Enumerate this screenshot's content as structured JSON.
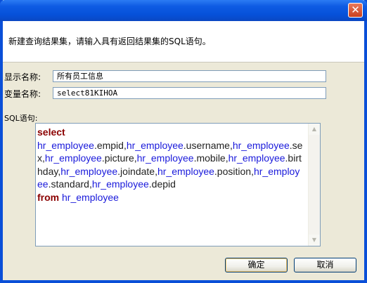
{
  "dialog": {
    "instruction": "新建查询结果集，请输入具有返回结果集的SQL语句。"
  },
  "fields": {
    "display_name_label": "显示名称:",
    "display_name_value": "所有员工信息",
    "variable_name_label": "变量名称:",
    "variable_name_value": "select81KIHOA",
    "sql_label": "SQL语句:"
  },
  "sql": {
    "tokens": [
      {
        "text": "select",
        "kind": "kw"
      },
      {
        "text": "\n"
      },
      {
        "text": " hr_employee",
        "kind": "tbl"
      },
      {
        "text": ".empid,",
        "kind": "col"
      },
      {
        "text": "hr_employee",
        "kind": "tbl"
      },
      {
        "text": ".username,",
        "kind": "col"
      },
      {
        "text": "hr_employee",
        "kind": "tbl"
      },
      {
        "text": ".sex,",
        "kind": "col"
      },
      {
        "text": "hr_employee",
        "kind": "tbl"
      },
      {
        "text": ".picture,",
        "kind": "col"
      },
      {
        "text": "hr_employee",
        "kind": "tbl"
      },
      {
        "text": ".mobile,",
        "kind": "col"
      },
      {
        "text": "hr_employee",
        "kind": "tbl"
      },
      {
        "text": ".birthday,",
        "kind": "col"
      },
      {
        "text": "hr_employee",
        "kind": "tbl"
      },
      {
        "text": ".joindate,",
        "kind": "col"
      },
      {
        "text": "hr_employee",
        "kind": "tbl"
      },
      {
        "text": ".position,",
        "kind": "col"
      },
      {
        "text": "hr_employee",
        "kind": "tbl"
      },
      {
        "text": ".standard,",
        "kind": "col"
      },
      {
        "text": "hr_employee",
        "kind": "tbl"
      },
      {
        "text": ".depid",
        "kind": "col"
      },
      {
        "text": "\n"
      },
      {
        "text": " from",
        "kind": "kw"
      },
      {
        "text": " hr_employee",
        "kind": "tbl"
      }
    ]
  },
  "buttons": {
    "ok_label": "确定",
    "cancel_label": "取消",
    "close_glyph": "✕"
  },
  "colors": {
    "keyword": "#8b0000",
    "table": "#1a1adb",
    "column": "#222222"
  }
}
